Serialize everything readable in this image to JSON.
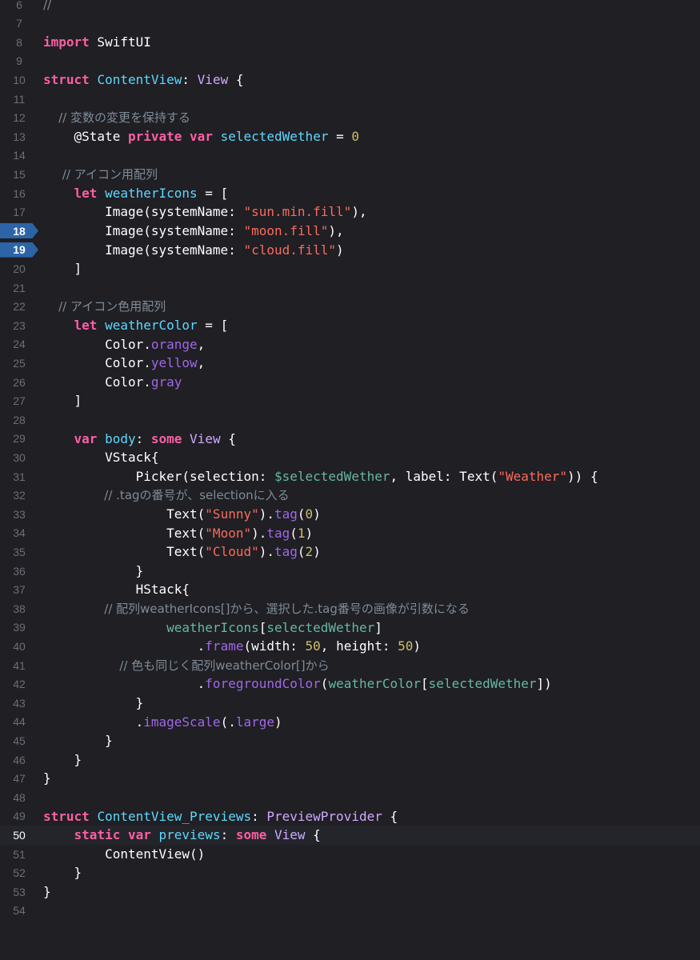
{
  "editor": {
    "current_line": 50,
    "breakpoints": [
      18,
      19
    ],
    "lines": [
      {
        "n": "6",
        "tokens": [
          {
            "t": "//",
            "c": "cm"
          }
        ]
      },
      {
        "n": "7",
        "tokens": []
      },
      {
        "n": "8",
        "tokens": [
          {
            "t": "import",
            "c": "kw"
          },
          {
            "t": " SwiftUI",
            "c": "pl"
          }
        ]
      },
      {
        "n": "9",
        "tokens": []
      },
      {
        "n": "10",
        "tokens": [
          {
            "t": "struct",
            "c": "kw"
          },
          {
            "t": " ",
            "c": "pl"
          },
          {
            "t": "ContentView",
            "c": "ty"
          },
          {
            "t": ": ",
            "c": "pl"
          },
          {
            "t": "View",
            "c": "cls"
          },
          {
            "t": " {",
            "c": "pl"
          }
        ]
      },
      {
        "n": "11",
        "tokens": []
      },
      {
        "n": "12",
        "tokens": [
          {
            "t": "    // 変数の変更を保持する",
            "c": "cm"
          }
        ]
      },
      {
        "n": "13",
        "tokens": [
          {
            "t": "    @State ",
            "c": "pl"
          },
          {
            "t": "private",
            "c": "kw"
          },
          {
            "t": " ",
            "c": "pl"
          },
          {
            "t": "var",
            "c": "kw"
          },
          {
            "t": " ",
            "c": "pl"
          },
          {
            "t": "selectedWether",
            "c": "ty"
          },
          {
            "t": " = ",
            "c": "pl"
          },
          {
            "t": "0",
            "c": "numlit"
          }
        ]
      },
      {
        "n": "14",
        "tokens": []
      },
      {
        "n": "15",
        "tokens": [
          {
            "t": "     // アイコン用配列",
            "c": "cm"
          }
        ]
      },
      {
        "n": "16",
        "tokens": [
          {
            "t": "    ",
            "c": "pl"
          },
          {
            "t": "let",
            "c": "kw"
          },
          {
            "t": " ",
            "c": "pl"
          },
          {
            "t": "weatherIcons",
            "c": "ty"
          },
          {
            "t": " = [",
            "c": "pl"
          }
        ]
      },
      {
        "n": "17",
        "tokens": [
          {
            "t": "        Image(systemName: ",
            "c": "pl"
          },
          {
            "t": "\"sun.min.fill\"",
            "c": "str"
          },
          {
            "t": "),",
            "c": "pl"
          }
        ]
      },
      {
        "n": "18",
        "tokens": [
          {
            "t": "        Image(systemName: ",
            "c": "pl"
          },
          {
            "t": "\"moon.fill\"",
            "c": "str"
          },
          {
            "t": "),",
            "c": "pl"
          }
        ]
      },
      {
        "n": "19",
        "tokens": [
          {
            "t": "        Image(systemName: ",
            "c": "pl"
          },
          {
            "t": "\"cloud.fill\"",
            "c": "str"
          },
          {
            "t": ")",
            "c": "pl"
          }
        ]
      },
      {
        "n": "20",
        "tokens": [
          {
            "t": "    ]",
            "c": "pl"
          }
        ]
      },
      {
        "n": "21",
        "tokens": []
      },
      {
        "n": "22",
        "tokens": [
          {
            "t": "    // アイコン色用配列",
            "c": "cm"
          }
        ]
      },
      {
        "n": "23",
        "tokens": [
          {
            "t": "    ",
            "c": "pl"
          },
          {
            "t": "let",
            "c": "kw"
          },
          {
            "t": " ",
            "c": "pl"
          },
          {
            "t": "weatherColor",
            "c": "ty"
          },
          {
            "t": " = [",
            "c": "pl"
          }
        ]
      },
      {
        "n": "24",
        "tokens": [
          {
            "t": "        Color.",
            "c": "pl"
          },
          {
            "t": "orange",
            "c": "mem"
          },
          {
            "t": ",",
            "c": "pl"
          }
        ]
      },
      {
        "n": "25",
        "tokens": [
          {
            "t": "        Color.",
            "c": "pl"
          },
          {
            "t": "yellow",
            "c": "mem"
          },
          {
            "t": ",",
            "c": "pl"
          }
        ]
      },
      {
        "n": "26",
        "tokens": [
          {
            "t": "        Color.",
            "c": "pl"
          },
          {
            "t": "gray",
            "c": "mem"
          }
        ]
      },
      {
        "n": "27",
        "tokens": [
          {
            "t": "    ]",
            "c": "pl"
          }
        ]
      },
      {
        "n": "28",
        "tokens": []
      },
      {
        "n": "29",
        "tokens": [
          {
            "t": "    ",
            "c": "pl"
          },
          {
            "t": "var",
            "c": "kw"
          },
          {
            "t": " ",
            "c": "pl"
          },
          {
            "t": "body",
            "c": "ty"
          },
          {
            "t": ": ",
            "c": "pl"
          },
          {
            "t": "some",
            "c": "kw"
          },
          {
            "t": " ",
            "c": "pl"
          },
          {
            "t": "View",
            "c": "cls"
          },
          {
            "t": " {",
            "c": "pl"
          }
        ]
      },
      {
        "n": "30",
        "tokens": [
          {
            "t": "        VStack{",
            "c": "pl"
          }
        ]
      },
      {
        "n": "31",
        "tokens": [
          {
            "t": "            Picker(selection: ",
            "c": "pl"
          },
          {
            "t": "$selectedWether",
            "c": "prop"
          },
          {
            "t": ", label: Text(",
            "c": "pl"
          },
          {
            "t": "\"Weather\"",
            "c": "str"
          },
          {
            "t": ")) {",
            "c": "pl"
          }
        ]
      },
      {
        "n": "32",
        "tokens": [
          {
            "t": "                // .tagの番号が、selectionに入る",
            "c": "cm"
          }
        ]
      },
      {
        "n": "33",
        "tokens": [
          {
            "t": "                Text(",
            "c": "pl"
          },
          {
            "t": "\"Sunny\"",
            "c": "str"
          },
          {
            "t": ").",
            "c": "pl"
          },
          {
            "t": "tag",
            "c": "mem"
          },
          {
            "t": "(",
            "c": "pl"
          },
          {
            "t": "0",
            "c": "numlit"
          },
          {
            "t": ")",
            "c": "pl"
          }
        ]
      },
      {
        "n": "34",
        "tokens": [
          {
            "t": "                Text(",
            "c": "pl"
          },
          {
            "t": "\"Moon\"",
            "c": "str"
          },
          {
            "t": ").",
            "c": "pl"
          },
          {
            "t": "tag",
            "c": "mem"
          },
          {
            "t": "(",
            "c": "pl"
          },
          {
            "t": "1",
            "c": "numlit"
          },
          {
            "t": ")",
            "c": "pl"
          }
        ]
      },
      {
        "n": "35",
        "tokens": [
          {
            "t": "                Text(",
            "c": "pl"
          },
          {
            "t": "\"Cloud\"",
            "c": "str"
          },
          {
            "t": ").",
            "c": "pl"
          },
          {
            "t": "tag",
            "c": "mem"
          },
          {
            "t": "(",
            "c": "pl"
          },
          {
            "t": "2",
            "c": "numlit"
          },
          {
            "t": ")",
            "c": "pl"
          }
        ]
      },
      {
        "n": "36",
        "tokens": [
          {
            "t": "            }",
            "c": "pl"
          }
        ]
      },
      {
        "n": "37",
        "tokens": [
          {
            "t": "            HStack{",
            "c": "pl"
          }
        ]
      },
      {
        "n": "38",
        "tokens": [
          {
            "t": "                // 配列weatherIcons[]から、選択した.tag番号の画像が引数になる",
            "c": "cm"
          }
        ]
      },
      {
        "n": "39",
        "tokens": [
          {
            "t": "                ",
            "c": "pl"
          },
          {
            "t": "weatherIcons",
            "c": "prop"
          },
          {
            "t": "[",
            "c": "pl"
          },
          {
            "t": "selectedWether",
            "c": "prop"
          },
          {
            "t": "]",
            "c": "pl"
          }
        ]
      },
      {
        "n": "40",
        "tokens": [
          {
            "t": "                    .",
            "c": "pl"
          },
          {
            "t": "frame",
            "c": "mem"
          },
          {
            "t": "(width: ",
            "c": "pl"
          },
          {
            "t": "50",
            "c": "numlit"
          },
          {
            "t": ", height: ",
            "c": "pl"
          },
          {
            "t": "50",
            "c": "numlit"
          },
          {
            "t": ")",
            "c": "pl"
          }
        ]
      },
      {
        "n": "41",
        "tokens": [
          {
            "t": "                    // 色も同じく配列weatherColor[]から",
            "c": "cm"
          }
        ]
      },
      {
        "n": "42",
        "tokens": [
          {
            "t": "                    .",
            "c": "pl"
          },
          {
            "t": "foregroundColor",
            "c": "mem"
          },
          {
            "t": "(",
            "c": "pl"
          },
          {
            "t": "weatherColor",
            "c": "prop"
          },
          {
            "t": "[",
            "c": "pl"
          },
          {
            "t": "selectedWether",
            "c": "prop"
          },
          {
            "t": "])",
            "c": "pl"
          }
        ]
      },
      {
        "n": "43",
        "tokens": [
          {
            "t": "            }",
            "c": "pl"
          }
        ]
      },
      {
        "n": "44",
        "tokens": [
          {
            "t": "            .",
            "c": "pl"
          },
          {
            "t": "imageScale",
            "c": "mem"
          },
          {
            "t": "(.",
            "c": "pl"
          },
          {
            "t": "large",
            "c": "mem"
          },
          {
            "t": ")",
            "c": "pl"
          }
        ]
      },
      {
        "n": "45",
        "tokens": [
          {
            "t": "        }",
            "c": "pl"
          }
        ]
      },
      {
        "n": "46",
        "tokens": [
          {
            "t": "    }",
            "c": "pl"
          }
        ]
      },
      {
        "n": "47",
        "tokens": [
          {
            "t": "}",
            "c": "pl"
          }
        ]
      },
      {
        "n": "48",
        "tokens": []
      },
      {
        "n": "49",
        "tokens": [
          {
            "t": "struct",
            "c": "kw"
          },
          {
            "t": " ",
            "c": "pl"
          },
          {
            "t": "ContentView_Previews",
            "c": "ty"
          },
          {
            "t": ": ",
            "c": "pl"
          },
          {
            "t": "PreviewProvider",
            "c": "cls"
          },
          {
            "t": " {",
            "c": "pl"
          }
        ]
      },
      {
        "n": "50",
        "tokens": [
          {
            "t": "    ",
            "c": "pl"
          },
          {
            "t": "static",
            "c": "kw"
          },
          {
            "t": " ",
            "c": "pl"
          },
          {
            "t": "var",
            "c": "kw"
          },
          {
            "t": " ",
            "c": "pl"
          },
          {
            "t": "previews",
            "c": "ty"
          },
          {
            "t": ": ",
            "c": "pl"
          },
          {
            "t": "some",
            "c": "kw"
          },
          {
            "t": " ",
            "c": "pl"
          },
          {
            "t": "View",
            "c": "cls"
          },
          {
            "t": " {",
            "c": "pl"
          }
        ]
      },
      {
        "n": "51",
        "tokens": [
          {
            "t": "        ContentView()",
            "c": "pl"
          }
        ]
      },
      {
        "n": "52",
        "tokens": [
          {
            "t": "    }",
            "c": "pl"
          }
        ]
      },
      {
        "n": "53",
        "tokens": [
          {
            "t": "}",
            "c": "pl"
          }
        ]
      },
      {
        "n": "54",
        "tokens": []
      }
    ]
  },
  "colors": {
    "background": "#1f1f24",
    "current_line_bg": "#23252b",
    "breakpoint": "#2d64a8",
    "keyword": "#fc5fa3",
    "type_decl": "#5dd8ff",
    "class_name": "#d0a8ff",
    "member": "#a167e6",
    "property": "#67b7a4",
    "string": "#fc6a5d",
    "number": "#d0bf69",
    "comment": "#7f8c98",
    "line_number": "#6c6f78"
  }
}
